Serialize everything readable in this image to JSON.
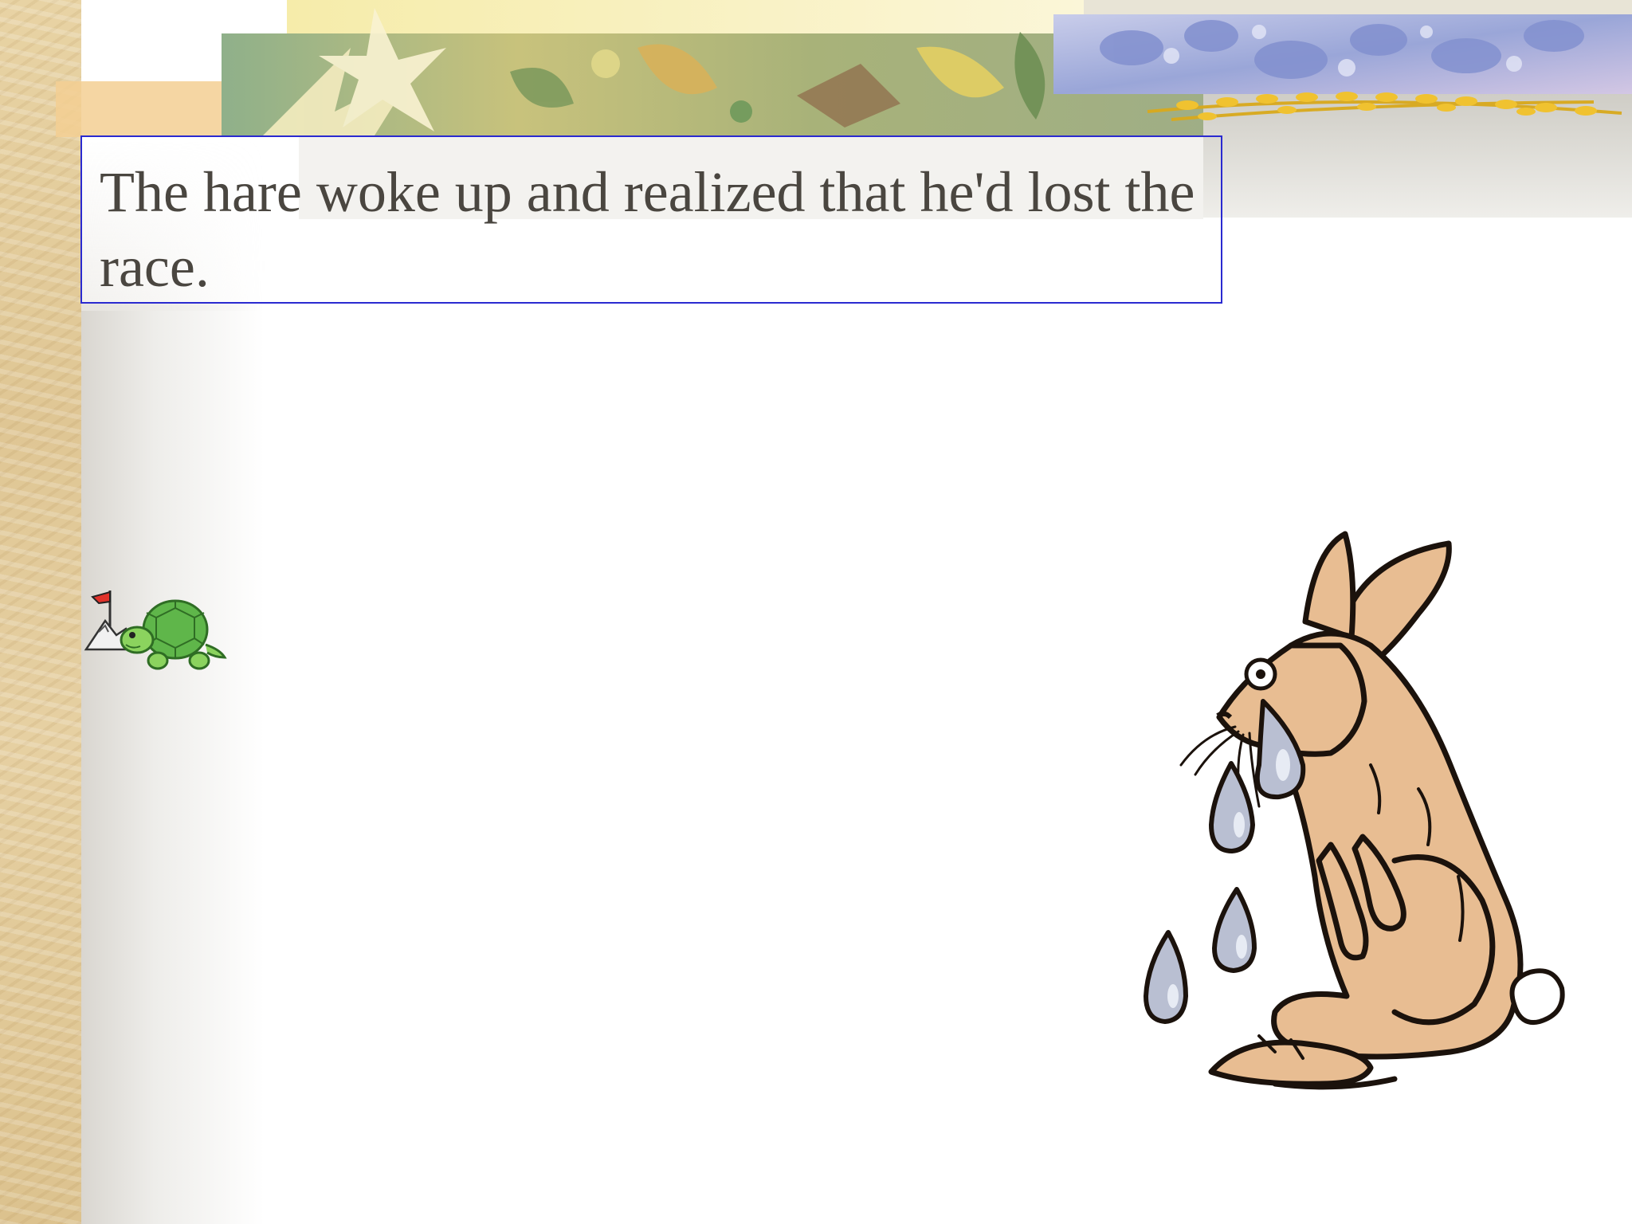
{
  "slide": {
    "text": "The hare woke up and realized that he'd lost the race."
  },
  "illustrations": {
    "tortoise": "tortoise-at-flag-clipart",
    "hare": "crying-hare-clipart"
  },
  "colors": {
    "text": "#4a4640",
    "box_border": "#2a2ad0",
    "hare_fur": "#e8bd92",
    "tear": "#b9bfd2",
    "tortoise_shell": "#5fb64a"
  }
}
